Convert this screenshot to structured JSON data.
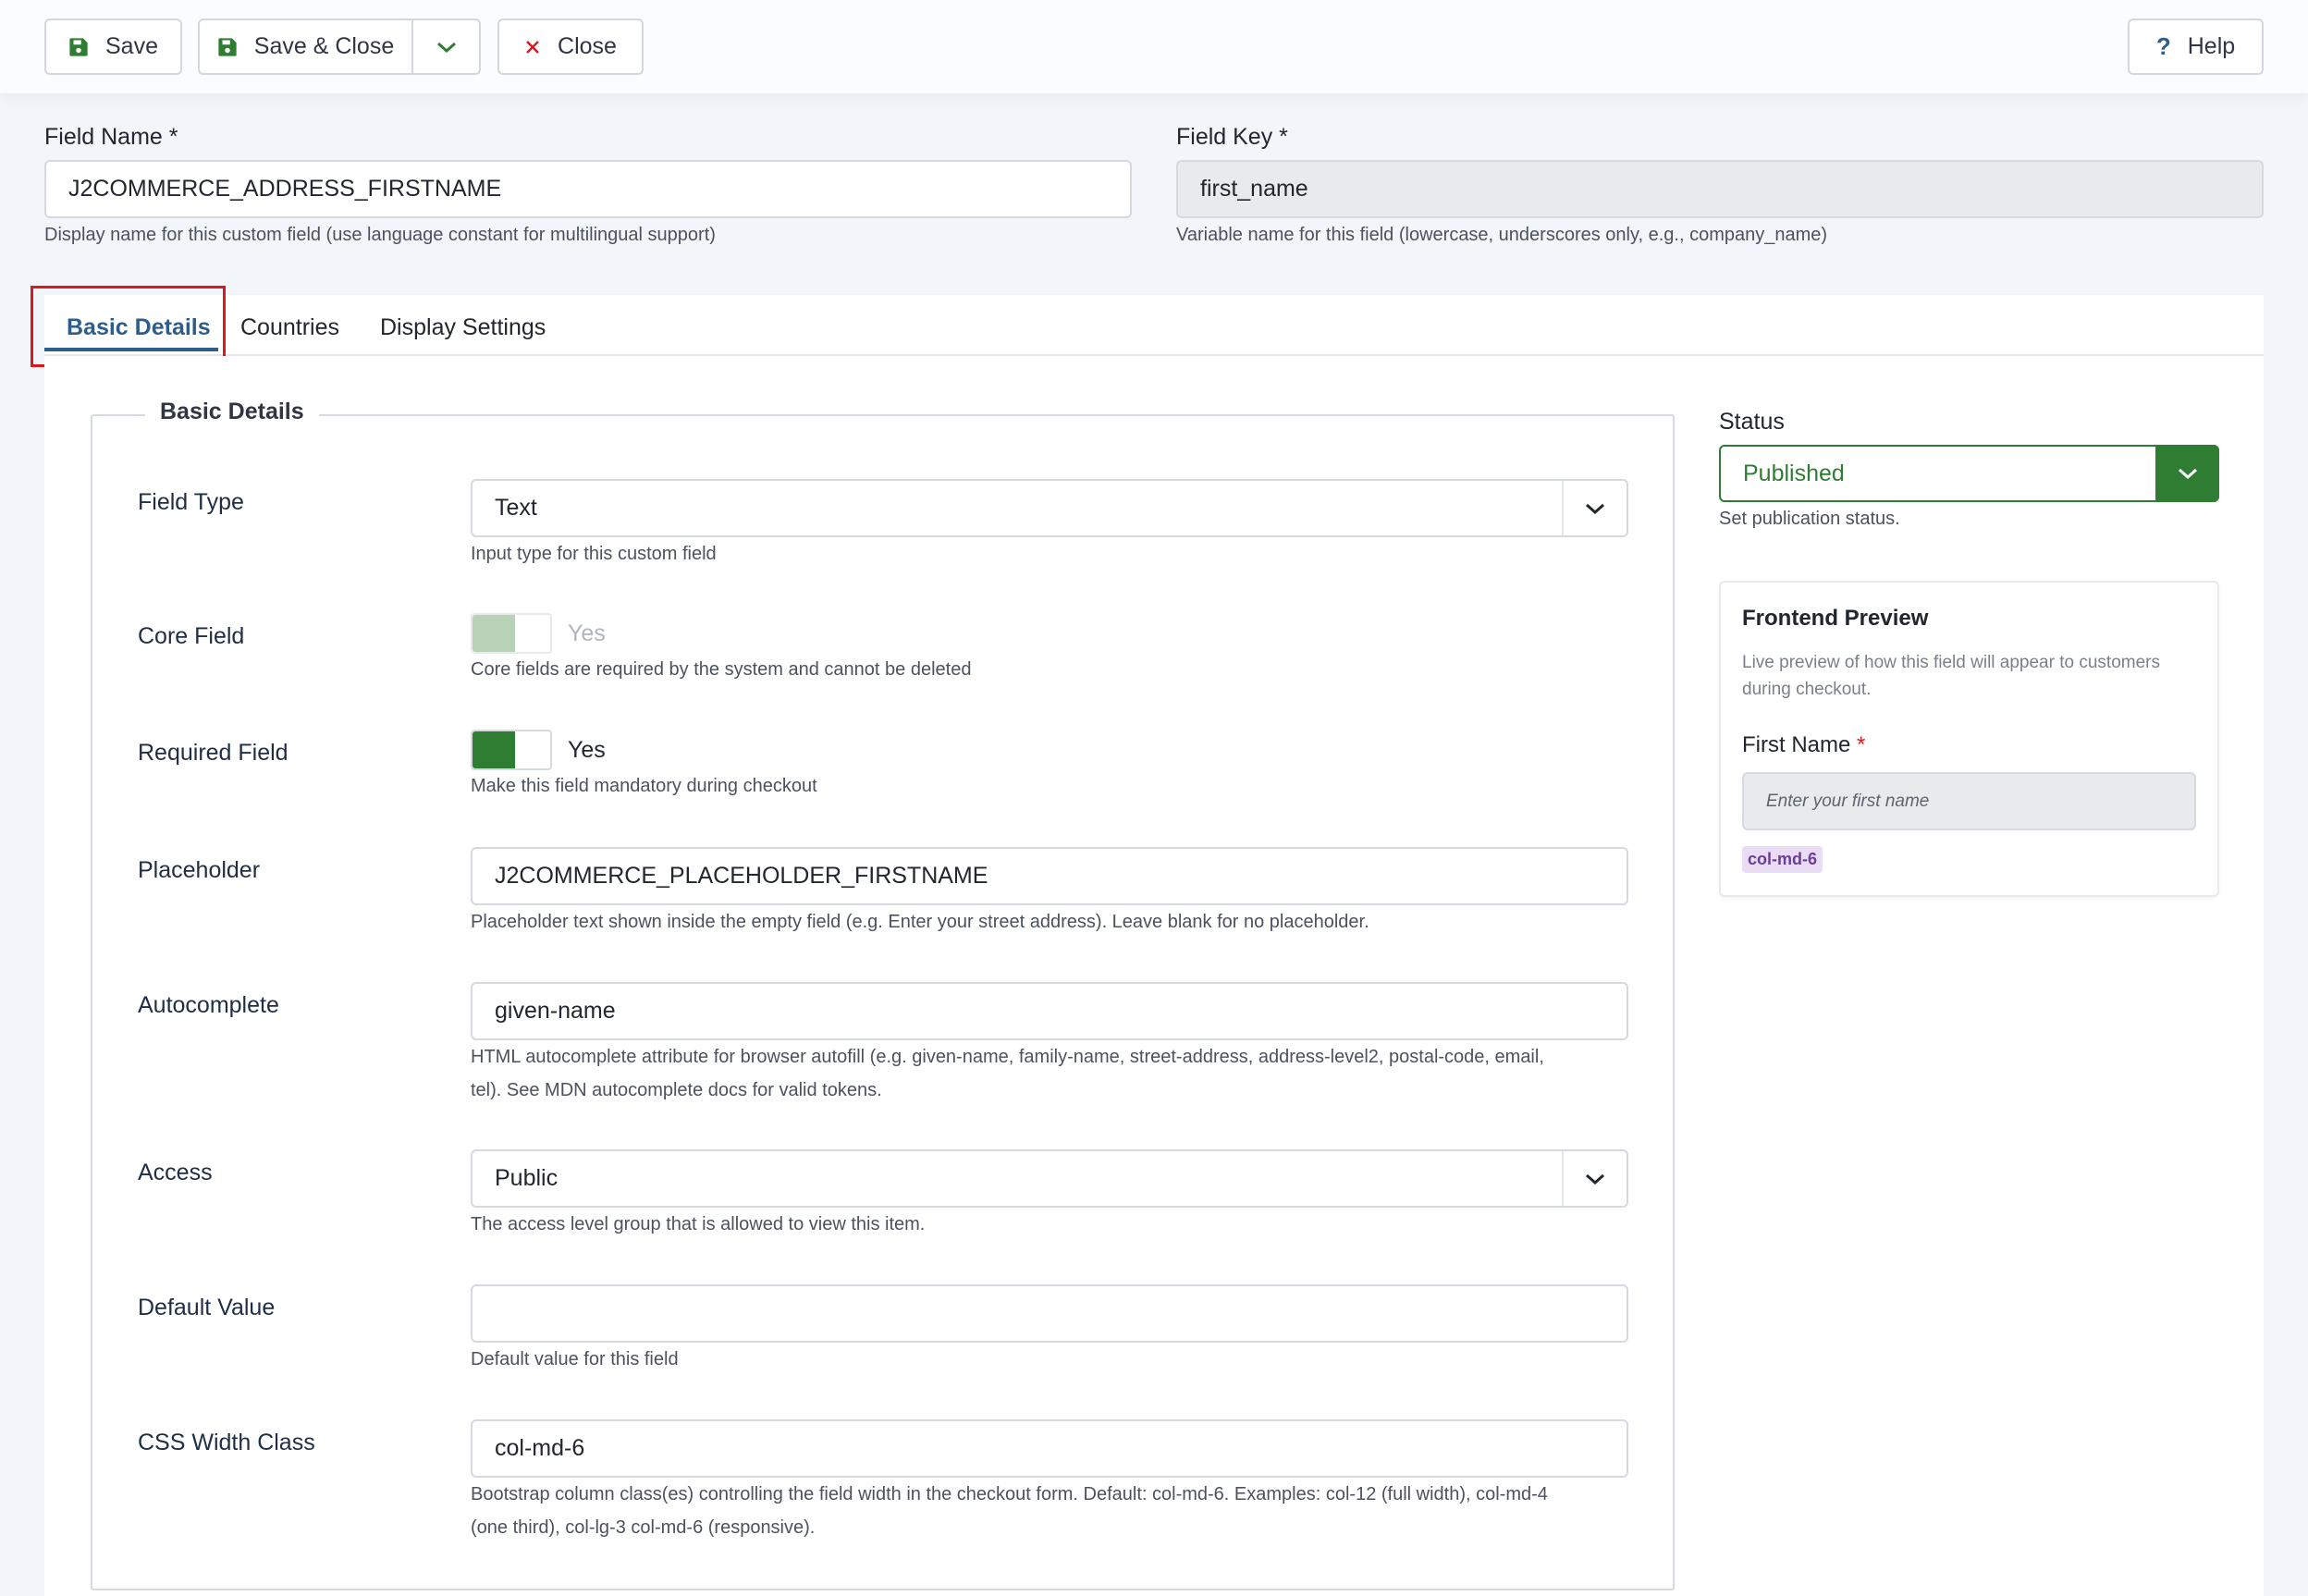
{
  "toolbar": {
    "save_label": "Save",
    "save_close_label": "Save & Close",
    "close_label": "Close",
    "help_label": "Help"
  },
  "field_name": {
    "label": "Field Name *",
    "value": "J2COMMERCE_ADDRESS_FIRSTNAME",
    "hint": "Display name for this custom field (use language constant for multilingual support)"
  },
  "field_key": {
    "label": "Field Key *",
    "value": "first_name",
    "hint": "Variable name for this field (lowercase, underscores only, e.g., company_name)"
  },
  "tabs": [
    {
      "label": "Basic Details",
      "active": true
    },
    {
      "label": "Countries",
      "active": false
    },
    {
      "label": "Display Settings",
      "active": false
    }
  ],
  "basic_details": {
    "legend": "Basic Details",
    "field_type": {
      "label": "Field Type",
      "value": "Text",
      "hint": "Input type for this custom field"
    },
    "core_field": {
      "label": "Core Field",
      "toggle_label": "Yes",
      "hint": "Core fields are required by the system and cannot be deleted"
    },
    "required_field": {
      "label": "Required Field",
      "toggle_label": "Yes",
      "hint": "Make this field mandatory during checkout"
    },
    "placeholder": {
      "label": "Placeholder",
      "value": "J2COMMERCE_PLACEHOLDER_FIRSTNAME",
      "hint": "Placeholder text shown inside the empty field (e.g. Enter your street address). Leave blank for no placeholder."
    },
    "autocomplete": {
      "label": "Autocomplete",
      "value": "given-name",
      "hint_line1": "HTML autocomplete attribute for browser autofill (e.g. given-name, family-name, street-address, address-level2, postal-code, email,",
      "hint_line2": "tel). See MDN autocomplete docs for valid tokens."
    },
    "access": {
      "label": "Access",
      "value": "Public",
      "hint": "The access level group that is allowed to view this item."
    },
    "default_value": {
      "label": "Default Value",
      "value": "",
      "hint": "Default value for this field"
    },
    "css_width": {
      "label": "CSS Width Class",
      "value": "col-md-6",
      "hint_line1": "Bootstrap column class(es) controlling the field width in the checkout form. Default: col-md-6. Examples: col-12 (full width), col-md-4",
      "hint_line2": "(one third), col-lg-3 col-md-6 (responsive)."
    }
  },
  "status": {
    "label": "Status",
    "value": "Published",
    "hint": "Set publication status."
  },
  "preview": {
    "title": "Frontend Preview",
    "description_line1": "Live preview of how this field will appear to customers",
    "description_line2": "during checkout.",
    "field_label": "First Name",
    "required_marker": "*",
    "input_placeholder": "Enter your first name",
    "width_badge": "col-md-6"
  },
  "colors": {
    "primary_tab": "#2f5d8a",
    "success": "#2f7d32",
    "danger": "#d71a20",
    "badge_bg": "#e9dcf4"
  }
}
